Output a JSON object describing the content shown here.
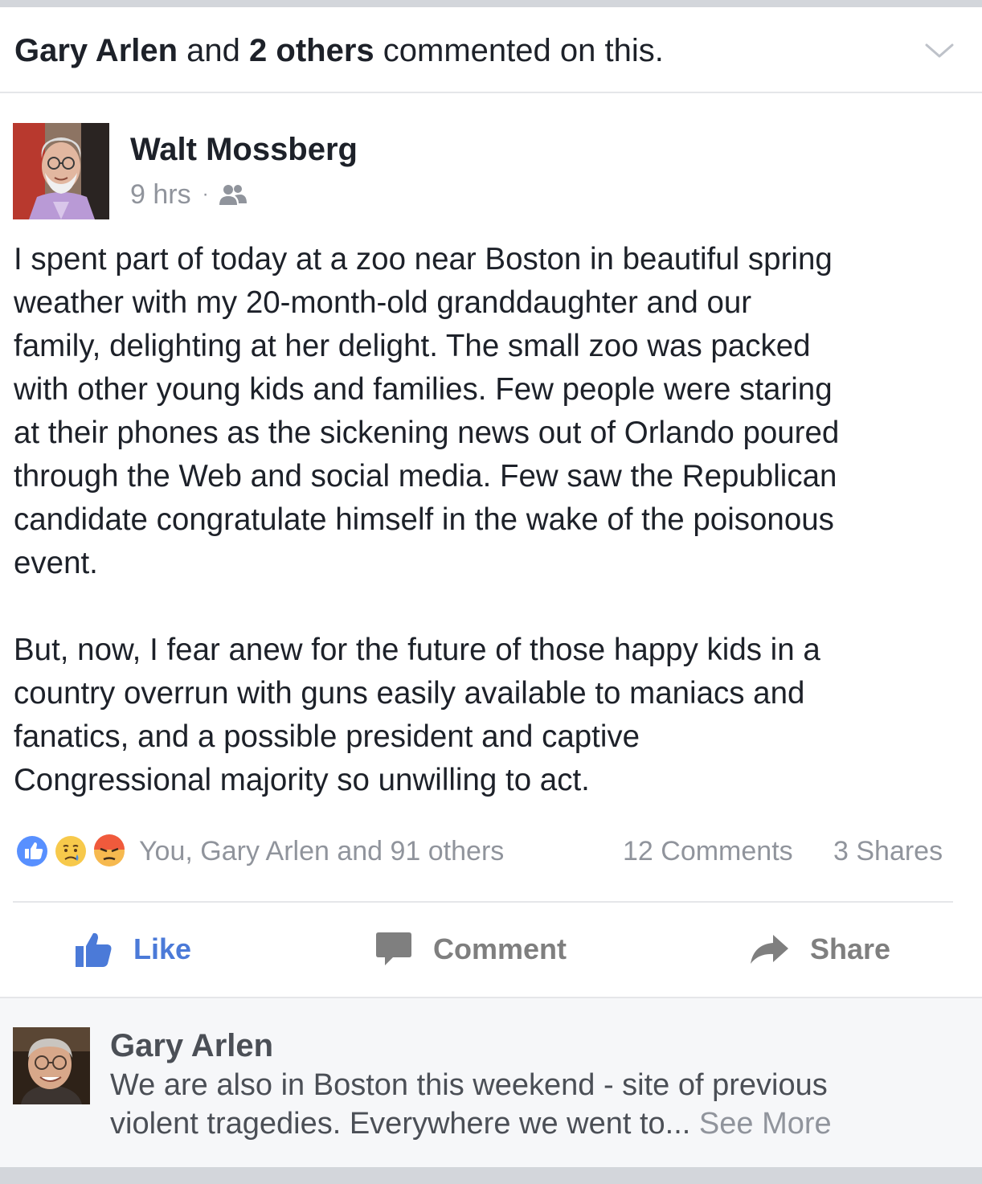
{
  "header": {
    "name": "Gary Arlen",
    "and_text": "and",
    "others": "2 others",
    "suffix": "commented on this."
  },
  "post": {
    "author": "Walt Mossberg",
    "time": "9 hrs",
    "separator": "·",
    "paragraphs": [
      "I spent part of today at a zoo near Boston in beautiful spring\nweather with my 20-month-old granddaughter and our\nfamily, delighting at her delight. The small zoo was packed\nwith other young kids and families. Few people were staring\nat their phones as the sickening news out of Orlando poured\nthrough the Web and social media. Few saw the Republican\ncandidate congratulate himself in the wake of the poisonous\nevent.",
      "But, now, I fear anew for the future of those happy kids in a\ncountry overrun with guns easily available to maniacs and\nfanatics, and a possible president and captive\nCongressional majority so unwilling to act."
    ],
    "reactions_text": "You, Gary Arlen and 91 others",
    "comments_count": "12 Comments",
    "shares_count": "3 Shares"
  },
  "actions": {
    "like": "Like",
    "comment": "Comment",
    "share": "Share"
  },
  "comment": {
    "author": "Gary Arlen",
    "text": "We are also in Boston this weekend - site of previous\nviolent tragedies.  Everywhere we went to...",
    "see_more": "See More"
  },
  "colors": {
    "like_blue": "#4b7ad8",
    "muted_gray": "#90949c",
    "text_dark": "#1d2129",
    "comment_bg": "#f6f7f9"
  },
  "icons": {
    "header": "chevron-down-icon",
    "privacy": "friends-icon",
    "reactions": [
      "like-reaction-icon",
      "sad-reaction-icon",
      "angry-reaction-icon"
    ],
    "like": "thumbs-up-icon",
    "comment": "speech-bubble-icon",
    "share": "share-arrow-icon"
  }
}
